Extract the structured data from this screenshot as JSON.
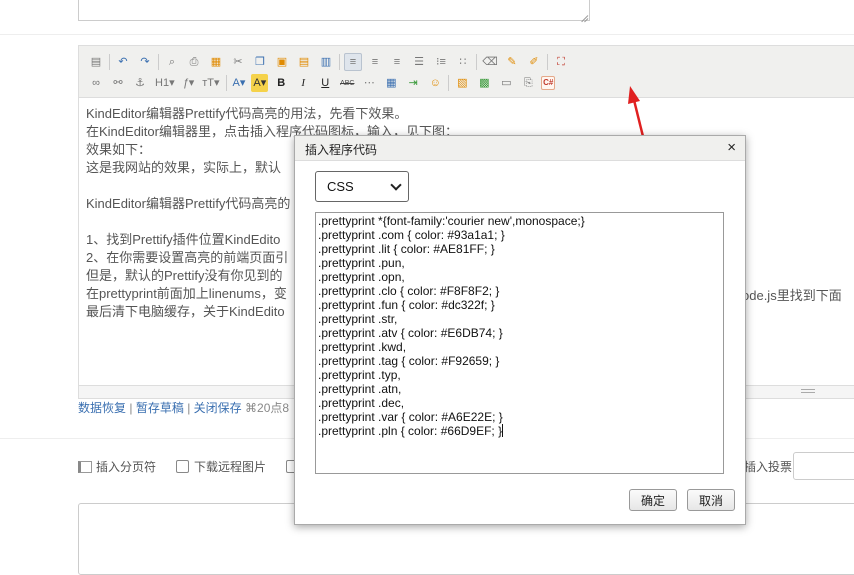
{
  "toolbar": {
    "row1": [
      "source-icon",
      "undo-icon",
      "redo-icon",
      "preview-icon",
      "print-icon",
      "template-icon",
      "cut-icon",
      "copy-icon",
      "paste-icon",
      "paste-text-icon",
      "paste-word-icon",
      "align-left-icon",
      "align-center-icon",
      "align-right-icon",
      "align-justify-icon",
      "ordered-list-icon",
      "unordered-list-icon",
      "clear-format-icon",
      "select-all-icon",
      "quick-format-icon",
      "fullscreen-icon"
    ],
    "heading_label": "H1",
    "font_label": "ƒ",
    "size_label": "тT",
    "bold_label": "B",
    "italic_label": "I",
    "underline_label": "U",
    "strike_label": "ABC",
    "code_label": "C#"
  },
  "editor": {
    "lines": [
      "KindEditor编辑器Prettify代码高亮的用法，先看下效果。",
      "在KindEditor编辑器里，点击插入程序代码图标，输入，见下图：",
      "效果如下：",
      "这是我网站的效果，实际上，默认",
      "",
      "KindEditor编辑器Prettify代码高亮的",
      "",
      "1、找到Prettify插件位置KindEdito",
      "2、在你需要设置高亮的前端页面引",
      "但是，默认的Prettify没有你见到的",
      "在prettyprint前面加上linenums，变",
      "最后清下电脑缓存，关于KindEdito"
    ],
    "overflow_text": "ode.js里找到下面"
  },
  "savebar": {
    "restore": "数据恢复",
    "pause": "暂存草稿",
    "close": "关闭保存",
    "sep": "|",
    "time": "⌘20点8"
  },
  "options": {
    "pagebreak": "插入分页符",
    "download_remote": "下载远程图片",
    "vote_label": "插入投票"
  },
  "dialog": {
    "title": "插入程序代码",
    "close": "×",
    "language": "CSS",
    "code_lines": [
      ".prettyprint *{font-family:'courier new',monospace;}",
      ".prettyprint .com { color: #93a1a1; }",
      ".prettyprint .lit { color: #AE81FF; }",
      ".prettyprint .pun,",
      ".prettyprint .opn,",
      ".prettyprint .clo { color: #F8F8F2; }",
      ".prettyprint .fun { color: #dc322f; }",
      ".prettyprint .str,",
      ".prettyprint .atv { color: #E6DB74; }",
      ".prettyprint .kwd,",
      ".prettyprint .tag { color: #F92659; }",
      ".prettyprint .typ,",
      ".prettyprint .atn,",
      ".prettyprint .dec,",
      ".prettyprint .var { color: #A6E22E; }",
      ".prettyprint .pln { color: #66D9EF; }"
    ],
    "ok": "确定",
    "cancel": "取消"
  },
  "colors": {
    "annotation_arrow": "#e02020",
    "link": "#3a6fb0"
  }
}
